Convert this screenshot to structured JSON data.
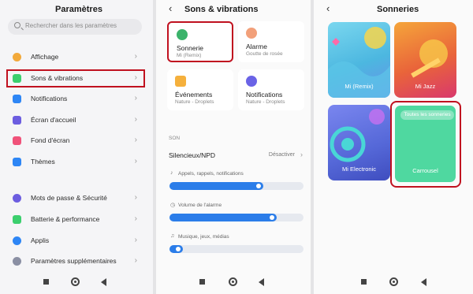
{
  "panel1": {
    "title": "Paramètres",
    "search_placeholder": "Rechercher dans les paramètres",
    "items": [
      {
        "label": "Affichage",
        "icon": "sun-icon",
        "color": "#f2a93b"
      },
      {
        "label": "Sons & vibrations",
        "icon": "speaker-icon",
        "color": "#3ccf6e"
      },
      {
        "label": "Notifications",
        "icon": "notification-icon",
        "color": "#2e86f5"
      },
      {
        "label": "Écran d'accueil",
        "icon": "home-icon",
        "color": "#6c5de0"
      },
      {
        "label": "Fond d'écran",
        "icon": "wallpaper-icon",
        "color": "#f0527a"
      },
      {
        "label": "Thèmes",
        "icon": "theme-icon",
        "color": "#2e86f5"
      },
      {
        "label": "Mots de passe & Sécurité",
        "icon": "fingerprint-icon",
        "color": "#6c5de0"
      },
      {
        "label": "Batterie & performance",
        "icon": "battery-icon",
        "color": "#3ccf6e"
      },
      {
        "label": "Applis",
        "icon": "gear-icon",
        "color": "#2e86f5"
      },
      {
        "label": "Paramètres supplémentaires",
        "icon": "more-icon",
        "color": "#8a8fa3"
      }
    ]
  },
  "panel2": {
    "title": "Sons & vibrations",
    "cards": [
      {
        "title": "Sonnerie",
        "subtitle": "Mi (Remix)",
        "icon": "phone-icon",
        "color": "#3bb36b"
      },
      {
        "title": "Alarme",
        "subtitle": "Goutte de rosée",
        "icon": "alarm-icon",
        "color": "#f2a07a"
      },
      {
        "title": "Événements",
        "subtitle": "Nature - Droplets",
        "icon": "event-icon",
        "color": "#f5b03c"
      },
      {
        "title": "Notifications",
        "subtitle": "Nature - Droplets",
        "icon": "bell-icon",
        "color": "#6a63e6"
      }
    ],
    "section": "SON",
    "silent_label": "Silencieux/NPD",
    "silent_value": "Désactiver",
    "volumes": [
      {
        "label": "Appels, rappels, notifications",
        "icon": "bell-icon",
        "level": 0.7
      },
      {
        "label": "Volume de l'alarme",
        "icon": "alarm-icon",
        "level": 0.8
      },
      {
        "label": "Musique, jeux, médias",
        "icon": "music-icon",
        "level": 0.1
      }
    ]
  },
  "panel3": {
    "title": "Sonneries",
    "tiles": [
      {
        "label": "Mi (Remix)",
        "color": "#5cc8e6"
      },
      {
        "label": "Mi Jazz",
        "color": "#f08a3a"
      },
      {
        "label": "Mi Electronic",
        "color": "#6b7be3"
      },
      {
        "label": "Carrousel",
        "color": "#4fd8a0"
      }
    ],
    "all_button": "Toutes les sonneries"
  },
  "colors": {
    "highlight": "#c0111f",
    "accent": "#2b7de9"
  }
}
